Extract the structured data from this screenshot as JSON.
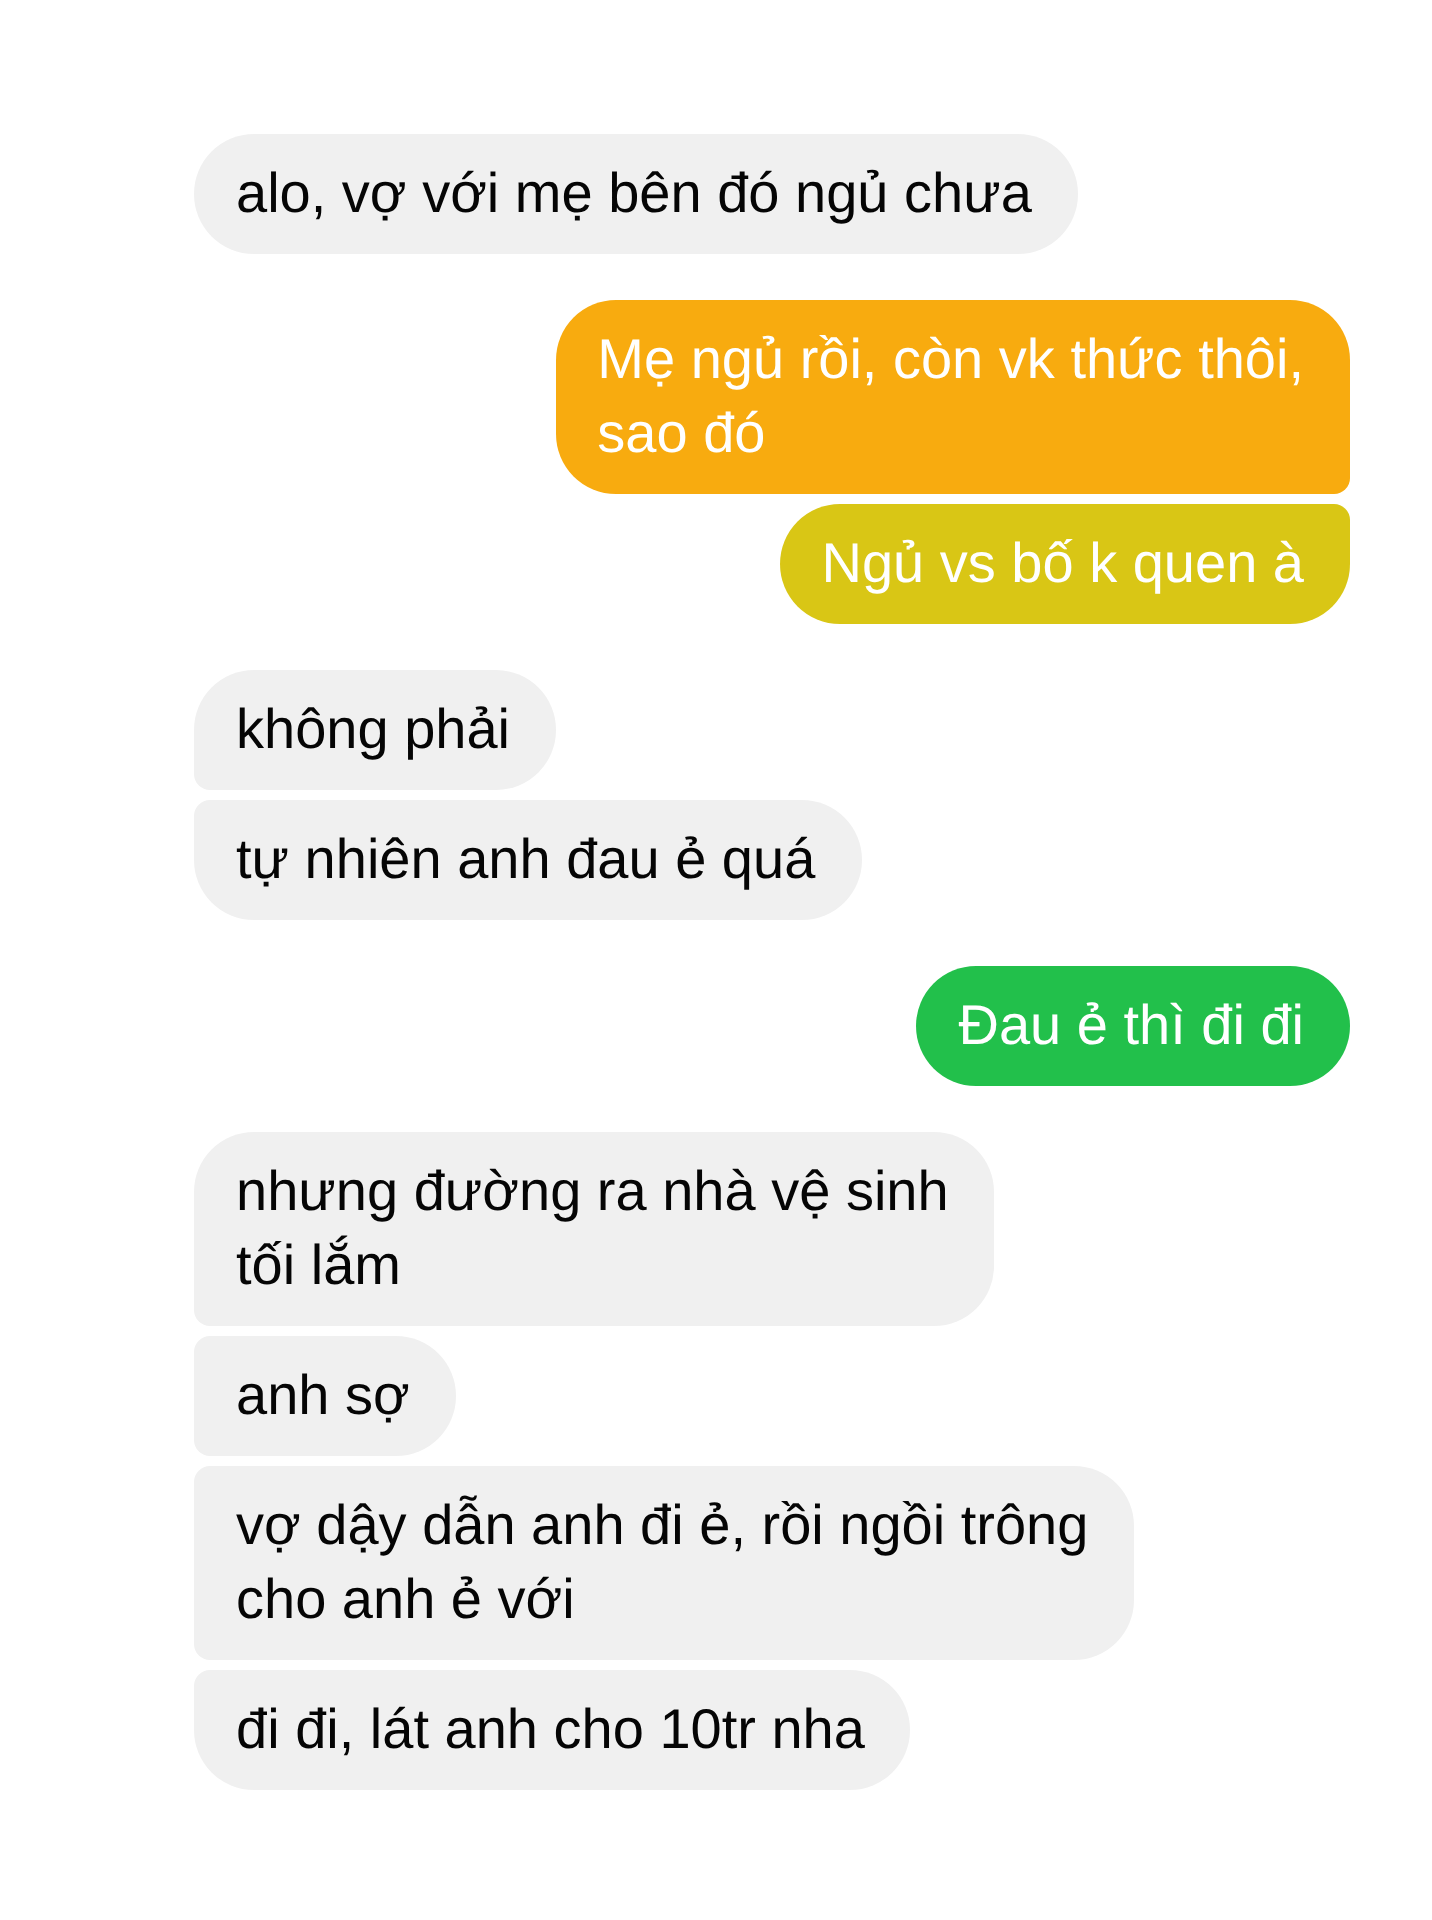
{
  "messages": [
    {
      "kind": "received",
      "lines": [
        "alo, vợ với mẹ bên đó ngủ chưa"
      ]
    },
    {
      "kind": "sent",
      "lines": [
        "Mẹ ngủ rồi, còn vk thức thôi,",
        "sao đó"
      ],
      "color": "#f8ab0f"
    },
    {
      "kind": "sent",
      "lines": [
        "Ngủ vs bố k quen à"
      ],
      "color": "#d9c615"
    },
    {
      "kind": "received",
      "lines": [
        "không phải"
      ]
    },
    {
      "kind": "received",
      "lines": [
        "tự nhiên anh đau ẻ quá"
      ]
    },
    {
      "kind": "sent",
      "lines": [
        "Đau ẻ thì đi đi"
      ],
      "color": "#22c04b"
    },
    {
      "kind": "received",
      "lines": [
        "nhưng đường ra nhà vệ sinh",
        "tối lắm"
      ]
    },
    {
      "kind": "received",
      "lines": [
        "anh sợ"
      ]
    },
    {
      "kind": "received",
      "lines": [
        "vợ dậy dẫn anh đi ẻ, rồi ngồi trông",
        "cho anh ẻ với"
      ]
    },
    {
      "kind": "received",
      "lines": [
        "đi đi, lát anh cho 10tr nha"
      ]
    }
  ]
}
